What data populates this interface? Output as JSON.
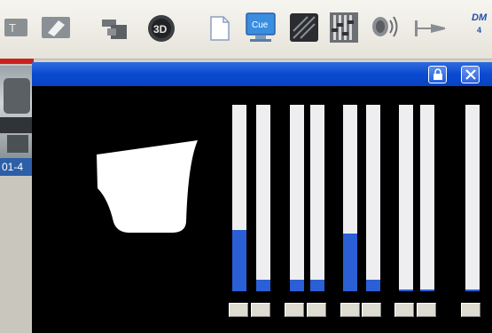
{
  "toolbar": {
    "icons": [
      "text-tool-icon",
      "layer-icon",
      "stack-icon",
      "3d-view-icon",
      "new-page-icon",
      "cue-monitor-icon",
      "fixture-lamp-icon",
      "faders-icon",
      "speaker-icon",
      "connector-icon",
      "dmx-logo-icon"
    ],
    "cue_label": "Cue",
    "three_d_label": "3D",
    "dmx_logo_text": "DM",
    "dmx_logo_sub": "4"
  },
  "left_panel": {
    "fixture_label": "01-4"
  },
  "window": {
    "title": "",
    "accent_color": "#0a4ad0",
    "fader_fill_color": "#2a5fd6",
    "faders": [
      {
        "level": 0.33
      },
      {
        "level": 0.06
      },
      {
        "level": 0.06
      },
      {
        "level": 0.06
      },
      {
        "level": 0.31
      },
      {
        "level": 0.06
      },
      {
        "level": 0.01
      },
      {
        "level": 0.01
      },
      {
        "level": 0.01
      }
    ]
  }
}
